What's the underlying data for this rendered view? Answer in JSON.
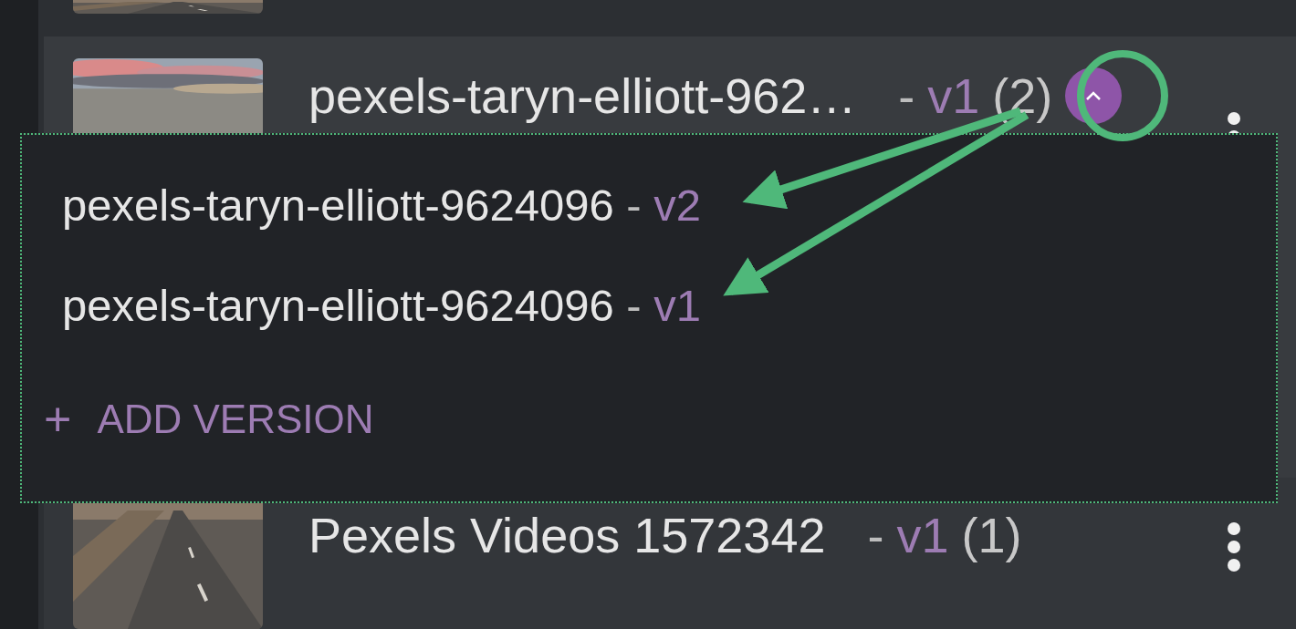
{
  "items": [
    {
      "title": "pexels-taryn-elliott-962…",
      "separator": "-",
      "version": "v1",
      "count": "(2)",
      "expanded": true
    },
    {
      "title": "Pexels Videos 1572342",
      "separator": "-",
      "version": "v1",
      "count": "(1)"
    }
  ],
  "versions_menu": {
    "versions": [
      {
        "name": "pexels-taryn-elliott-9624096",
        "separator": "-",
        "version": "v2"
      },
      {
        "name": "pexels-taryn-elliott-9624096",
        "separator": "-",
        "version": "v1"
      }
    ],
    "add_button": {
      "icon": "+",
      "label": "ADD VERSION"
    }
  }
}
